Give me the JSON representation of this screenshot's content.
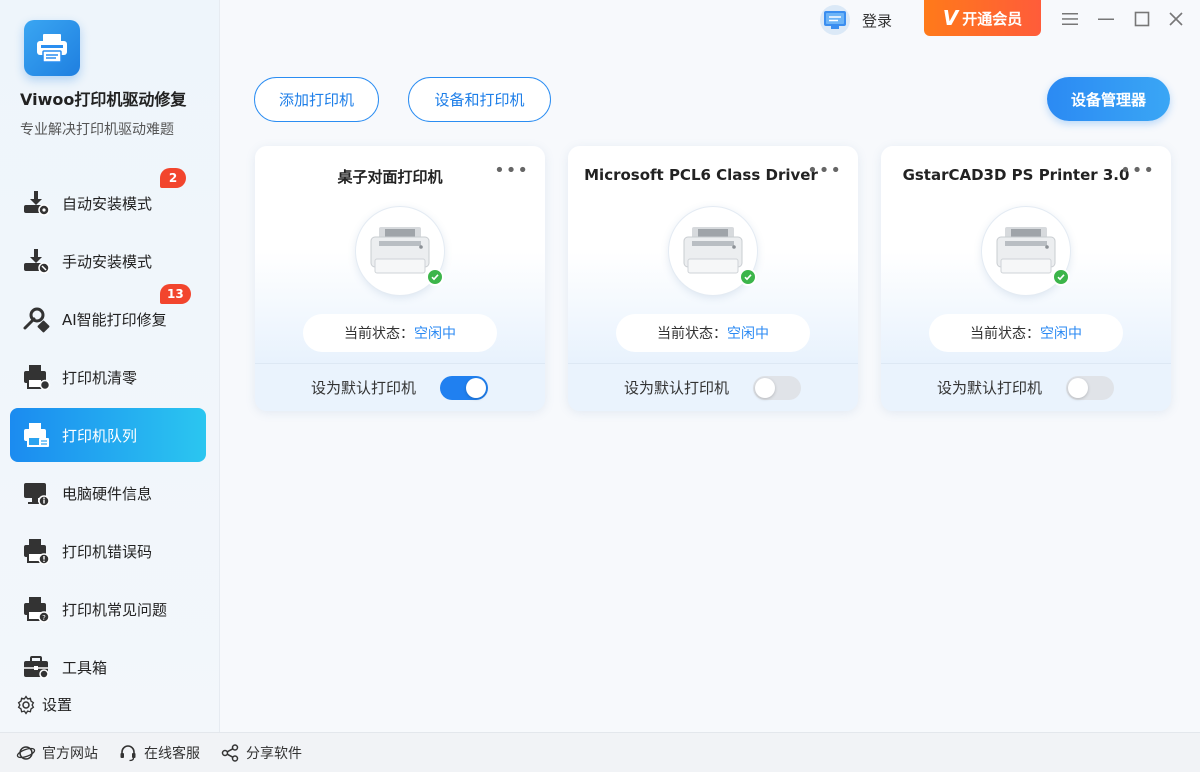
{
  "app": {
    "name": "Viwoo打印机驱动修复",
    "subtitle": "专业解决打印机驱动难题"
  },
  "sidebar": {
    "items": [
      {
        "label": "自动安装模式",
        "badge": "2",
        "icon": "download-install-icon"
      },
      {
        "label": "手动安装模式",
        "badge": "",
        "icon": "download-manual-icon"
      },
      {
        "label": "AI智能打印修复",
        "badge": "13",
        "icon": "repair-tools-icon"
      },
      {
        "label": "打印机清零",
        "badge": "",
        "icon": "printer-reset-icon"
      },
      {
        "label": "打印机队列",
        "badge": "",
        "icon": "printer-queue-icon",
        "active": true
      },
      {
        "label": "电脑硬件信息",
        "badge": "",
        "icon": "computer-info-icon"
      },
      {
        "label": "打印机错误码",
        "badge": "",
        "icon": "printer-error-icon"
      },
      {
        "label": "打印机常见问题",
        "badge": "",
        "icon": "printer-faq-icon"
      },
      {
        "label": "工具箱",
        "badge": "",
        "icon": "toolbox-icon"
      }
    ],
    "settings_label": "设置"
  },
  "footer": {
    "website": "官方网站",
    "support": "在线客服",
    "share": "分享软件"
  },
  "topbar": {
    "login": "登录",
    "vip_label": "开通会员",
    "vip_mark": "V"
  },
  "actions": {
    "add_printer": "添加打印机",
    "devices_printers": "设备和打印机",
    "device_manager": "设备管理器"
  },
  "printers": [
    {
      "name": "桌子对面打印机",
      "status_label": "当前状态：",
      "status_value": "空闲中",
      "default_label": "设为默认打印机",
      "is_default": true
    },
    {
      "name": "Microsoft PCL6 Class Driver",
      "status_label": "当前状态：",
      "status_value": "空闲中",
      "default_label": "设为默认打印机",
      "is_default": false
    },
    {
      "name": "GstarCAD3D PS Printer 3.0",
      "status_label": "当前状态：",
      "status_value": "空闲中",
      "default_label": "设为默认打印机",
      "is_default": false
    }
  ],
  "colors": {
    "accent": "#2b8af3",
    "vip": "#ff6a2a",
    "badge": "#f2452d",
    "success": "#3cb54a"
  }
}
